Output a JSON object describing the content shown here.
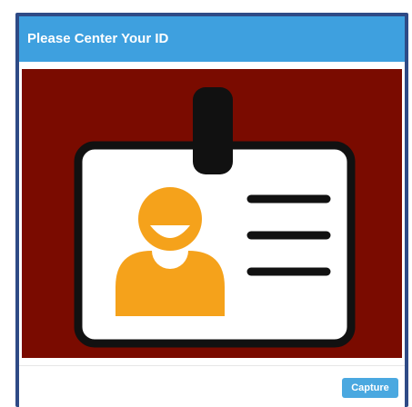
{
  "dialog": {
    "title": "Please Center Your ID",
    "capture_label": "Capture"
  },
  "colors": {
    "header": "#3ea0df",
    "camera_background": "#7a0b00",
    "card": "#ffffff",
    "card_outline": "#111111",
    "avatar": "#f5a21b",
    "button": "#4aa8e0"
  },
  "icons": {
    "card": "id-card-icon",
    "clip": "badge-clip-icon",
    "avatar": "person-avatar-icon",
    "lines": "text-lines-icon"
  }
}
